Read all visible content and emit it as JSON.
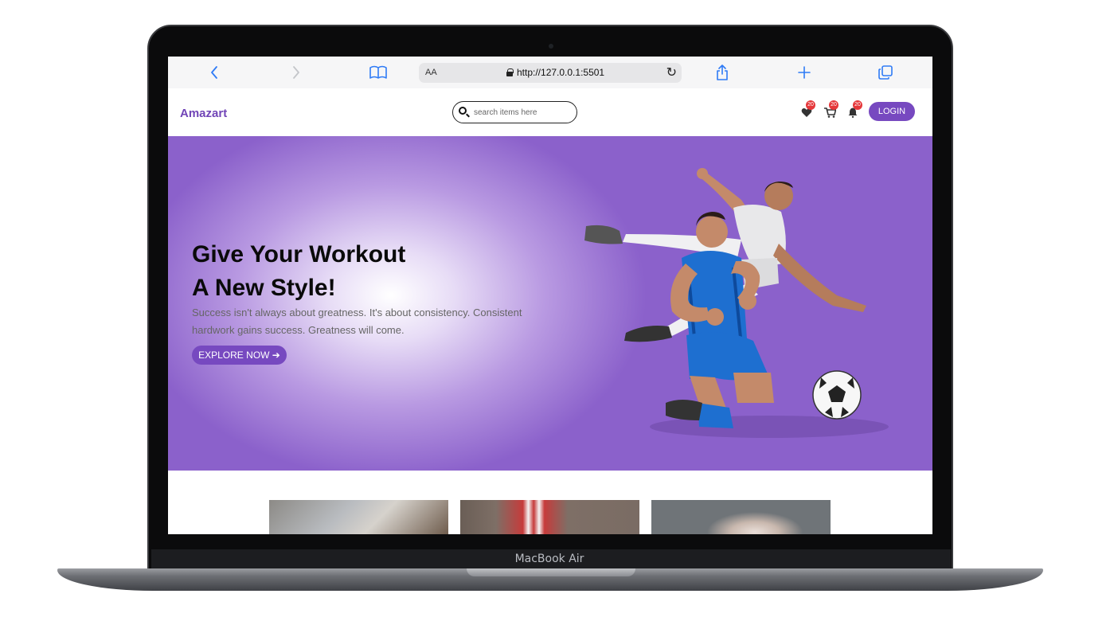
{
  "device": {
    "model_label": "MacBook Air"
  },
  "browser": {
    "url": "http://127.0.0.1:5501",
    "text_size_label": "AA",
    "icons": [
      "back-icon",
      "forward-icon",
      "bookmarks-icon",
      "reload-icon",
      "share-icon",
      "new-tab-icon",
      "tabs-icon"
    ]
  },
  "header": {
    "brand": "Amazart",
    "search_placeholder": "search items here",
    "wishlist_count": "20",
    "cart_count": "20",
    "notifications_count": "20",
    "login_label": "LOGIN"
  },
  "hero": {
    "title_line1": "Give Your Workout",
    "title_line2": "A New Style!",
    "subtitle": "Success isn't always about greatness. It's about consistency. Consistent hardwork gains success. Greatness will come.",
    "cta_label": "EXPLORE NOW ➔"
  },
  "colors": {
    "accent": "#7749c0",
    "brand": "#7145b7",
    "hero_edge": "#8b61cb",
    "badge": "#e5383b",
    "safari_blue": "#2f7bf6"
  }
}
